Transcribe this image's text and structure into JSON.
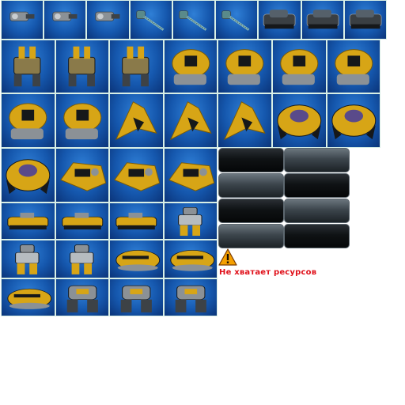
{
  "sprite_sheet": {
    "background": "#ffffff",
    "tile_background_color": "#1a5bb0",
    "tile_border_color": "#d8efe6",
    "rows": [
      [
        "cannon-gray",
        "cannon-gray",
        "cannon-gray",
        "rifle-teal",
        "rifle-teal",
        "rifle-teal",
        "tank-dark",
        "tank-dark",
        "tank-dark"
      ],
      [
        "mech-walker",
        "mech-walker",
        "mech-walker",
        "turret-pod",
        "turret-pod",
        "turret-pod",
        "turret-pod"
      ],
      [
        "turret-pod",
        "turret-pod",
        "fighter-craft",
        "fighter-craft",
        "fighter-craft",
        "armor-shell",
        "armor-shell"
      ],
      [
        "armor-shell",
        "hover-tank",
        "hover-tank",
        "hover-tank"
      ],
      [
        "crawler",
        "crawler",
        "crawler",
        "robot-soldier"
      ],
      [
        "robot-soldier",
        "robot-soldier",
        "boat-hull",
        "boat-hull"
      ],
      [
        "boat-hull",
        "heavy-mech",
        "heavy-mech",
        "heavy-mech"
      ]
    ]
  },
  "buttons": {
    "rows": [
      [
        "dark",
        "light"
      ],
      [
        "light",
        "dark"
      ],
      [
        "dark",
        "light"
      ],
      [
        "light",
        "dark"
      ]
    ]
  },
  "warning": {
    "icon": "warning-triangle-icon",
    "text": "Не хватает ресурсов",
    "text_color": "#e0101a",
    "icon_color": "#f5a000"
  }
}
